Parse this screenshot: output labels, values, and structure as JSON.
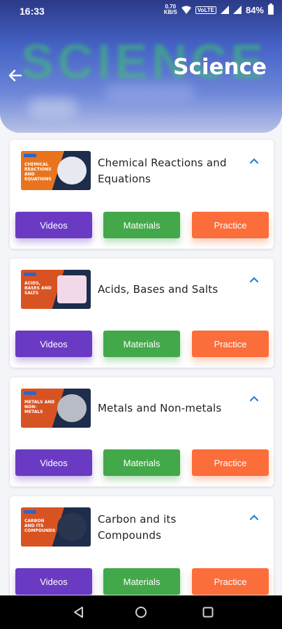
{
  "status": {
    "time": "16:33",
    "net_speed_top": "0.70",
    "net_speed_unit": "KB/S",
    "volte": "VoLTE",
    "battery": "84%"
  },
  "header": {
    "title": "Science",
    "background_word": "SCIENCE"
  },
  "chapters": [
    {
      "title": "Chemical Reactions and Equations",
      "thumb_label": "Chemical Reactions and Equations",
      "videos_label": "Videos",
      "materials_label": "Materials",
      "practice_label": "Practice"
    },
    {
      "title": "Acids, Bases and Salts",
      "thumb_label": "Acids, Bases and Salts",
      "videos_label": "Videos",
      "materials_label": "Materials",
      "practice_label": "Practice"
    },
    {
      "title": "Metals and Non-metals",
      "thumb_label": "Metals and Non-metals",
      "videos_label": "Videos",
      "materials_label": "Materials",
      "practice_label": "Practice"
    },
    {
      "title": "Carbon and its Compounds",
      "thumb_label": "Carbon and its Compounds",
      "videos_label": "Videos",
      "materials_label": "Materials",
      "practice_label": "Practice"
    }
  ],
  "colors": {
    "videos": "#6a3bc2",
    "materials": "#43a84a",
    "practice": "#fb6d3a",
    "chevron": "#2a7fd4"
  },
  "icons": {
    "back": "arrow-left-icon",
    "expand": "chevron-up-icon",
    "nav_back": "triangle-back-icon",
    "nav_home": "circle-home-icon",
    "nav_recents": "square-recents-icon"
  }
}
